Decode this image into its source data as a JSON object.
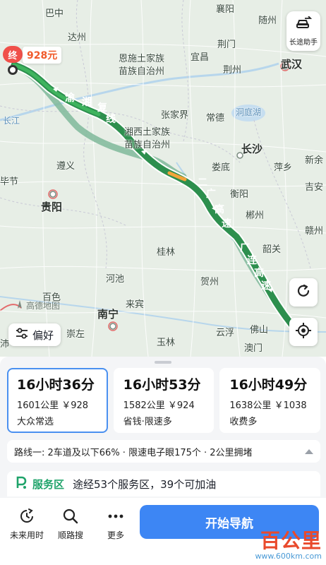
{
  "map": {
    "end_marker": "终",
    "toll_tag": "928元",
    "assistant_label": "长途助手",
    "watermark": "高德地图",
    "preference_label": "偏好",
    "cities": [
      {
        "name": "巴中",
        "cls": ""
      },
      {
        "name": "达州",
        "cls": ""
      },
      {
        "name": "襄阳",
        "cls": ""
      },
      {
        "name": "随州",
        "cls": ""
      },
      {
        "name": "荆门",
        "cls": ""
      },
      {
        "name": "恩施土家族",
        "cls": ""
      },
      {
        "name": "苗族自治州",
        "cls": ""
      },
      {
        "name": "宜昌",
        "cls": ""
      },
      {
        "name": "荆州",
        "cls": ""
      },
      {
        "name": "武汉",
        "cls": "big"
      },
      {
        "name": "长江",
        "cls": "water"
      },
      {
        "name": "张家界",
        "cls": ""
      },
      {
        "name": "常德",
        "cls": ""
      },
      {
        "name": "洞庭湖",
        "cls": "water"
      },
      {
        "name": "湘西土家族",
        "cls": ""
      },
      {
        "name": "苗族自治州",
        "cls": ""
      },
      {
        "name": "长沙",
        "cls": "big"
      },
      {
        "name": "遵义",
        "cls": ""
      },
      {
        "name": "娄底",
        "cls": ""
      },
      {
        "name": "萍乡",
        "cls": ""
      },
      {
        "name": "新余",
        "cls": ""
      },
      {
        "name": "毕节",
        "cls": ""
      },
      {
        "name": "衡阳",
        "cls": ""
      },
      {
        "name": "吉安",
        "cls": ""
      },
      {
        "name": "贵阳",
        "cls": "big"
      },
      {
        "name": "郴州",
        "cls": ""
      },
      {
        "name": "赣州",
        "cls": ""
      },
      {
        "name": "桂林",
        "cls": ""
      },
      {
        "name": "韶关",
        "cls": ""
      },
      {
        "name": "河池",
        "cls": ""
      },
      {
        "name": "贺州",
        "cls": ""
      },
      {
        "name": "百色",
        "cls": ""
      },
      {
        "name": "来宾",
        "cls": ""
      },
      {
        "name": "南宁",
        "cls": "big"
      },
      {
        "name": "崇左",
        "cls": ""
      },
      {
        "name": "云浮",
        "cls": ""
      },
      {
        "name": "佛山",
        "cls": ""
      },
      {
        "name": "玉林",
        "cls": ""
      },
      {
        "name": "澳门",
        "cls": ""
      },
      {
        "name": "沛",
        "cls": ""
      }
    ],
    "road_labels": [
      "渝",
      "湘",
      "复",
      "线",
      "二",
      "广",
      "高",
      "速",
      "广",
      "连",
      "高",
      "速"
    ]
  },
  "routes": [
    {
      "time": "16小时36分",
      "distance": "1601公里",
      "toll": "￥928",
      "tag": "大众常选",
      "selected": true
    },
    {
      "time": "16小时53分",
      "distance": "1582公里",
      "toll": "￥924",
      "tag": "省钱·限速多",
      "selected": false
    },
    {
      "time": "16小时49分",
      "distance": "1638公里",
      "toll": "￥1038",
      "tag": "收费多",
      "selected": false
    }
  ],
  "info_bar": "路线一: 2车道及以下66% · 限速电子眼175个 · 2公里拥堵",
  "service": {
    "title": "服务区",
    "detail": "途经53个服务区，39个可加油"
  },
  "actions": {
    "future": "未来用时",
    "along": "顺路搜",
    "more": "更多",
    "start": "开始导航"
  },
  "brand": {
    "name": "百公里",
    "url": "www.600km.com"
  },
  "colors": {
    "route_main": "#2d8f4e",
    "route_alt": "#7fb89a",
    "accent": "#3d86f4",
    "service_green": "#1fa36a",
    "end_red": "#f0504a"
  }
}
